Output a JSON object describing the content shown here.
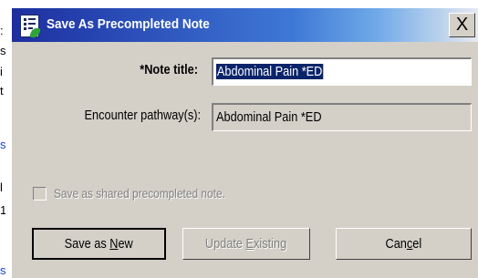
{
  "background_fragments": [
    ":",
    "s",
    "i",
    "t",
    "s",
    "l",
    "1",
    "s"
  ],
  "dialog": {
    "title": "Save As Precompleted Note",
    "close_label": "X",
    "note_title": {
      "label": "*Note title:",
      "value": "Abdominal Pain *ED"
    },
    "encounter_pathway": {
      "label": "Encounter pathway(s):",
      "value": "Abdominal Pain *ED"
    },
    "shared_checkbox": {
      "label": "Save as shared precompleted note.",
      "checked": false,
      "enabled": false
    },
    "buttons": {
      "save_new": {
        "prefix": "Save as ",
        "mnemonic": "N",
        "suffix": "ew"
      },
      "update_existing": {
        "prefix": "Update ",
        "mnemonic": "E",
        "suffix": "xisting",
        "enabled": false
      },
      "cancel": {
        "prefix": "Can",
        "mnemonic": "c",
        "suffix": "el"
      }
    }
  },
  "colors": {
    "title_gradient_start": "#1d2fa0",
    "title_gradient_end": "#e8eaf0",
    "dialog_face": "#d4d0c8",
    "selection": "#0a246a",
    "link_blue": "#1a3fd1"
  }
}
